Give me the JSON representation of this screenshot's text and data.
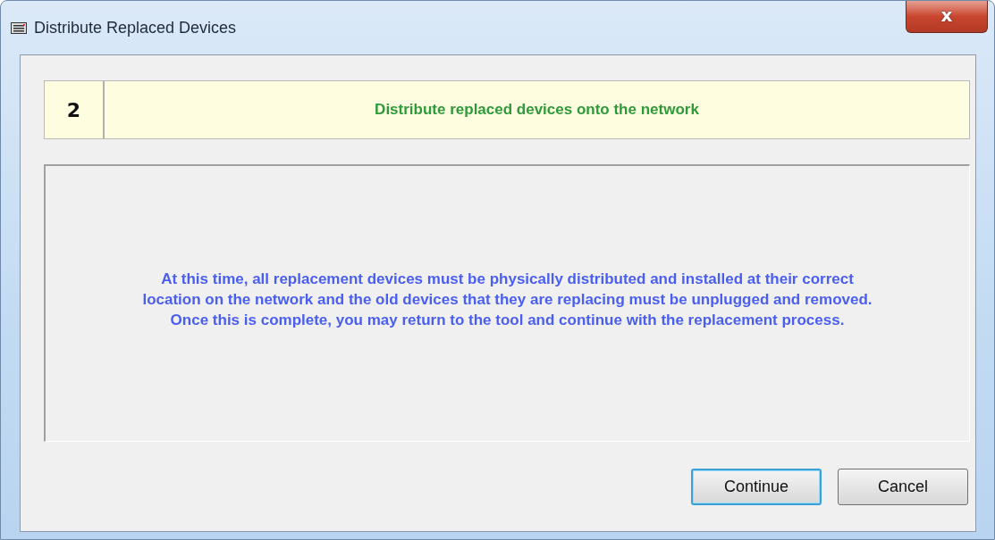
{
  "window": {
    "title": "Distribute Replaced Devices",
    "close_label": "x"
  },
  "step": {
    "number": "2",
    "title": "Distribute replaced devices onto the network"
  },
  "message": "At this time, all replacement devices must be physically distributed and installed at their correct location on the network and the old devices that they are replacing must be unplugged and removed.  Once this is complete, you may return to the tool and continue with the replacement process.",
  "buttons": [
    {
      "label": "Continue",
      "default": true
    },
    {
      "label": "Cancel",
      "default": false
    }
  ]
}
